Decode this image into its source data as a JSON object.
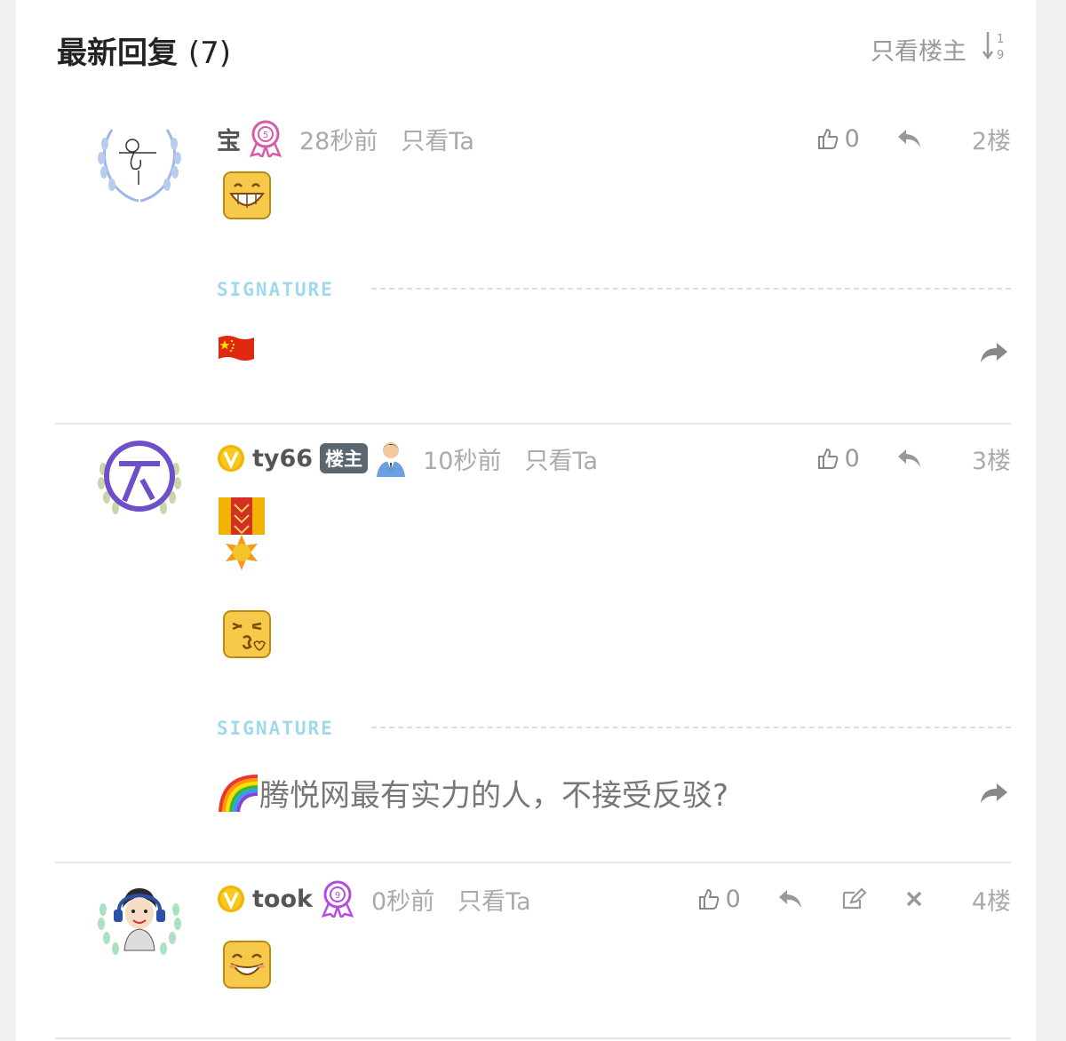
{
  "header": {
    "title": "最新回复",
    "count": "(7)",
    "only_op": "只看楼主"
  },
  "posts": [
    {
      "username": "宝",
      "time": "28秒前",
      "only_ta": "只看Ta",
      "likes": "0",
      "floor": "2楼",
      "signature_label": "SIGNATURE",
      "signature_text": ""
    },
    {
      "username": "ty66",
      "op_badge": "楼主",
      "time": "10秒前",
      "only_ta": "只看Ta",
      "likes": "0",
      "floor": "3楼",
      "signature_label": "SIGNATURE",
      "signature_text": "腾悦网最有实力的人，不接受反驳?"
    },
    {
      "username": "took",
      "time": "0秒前",
      "only_ta": "只看Ta",
      "likes": "0",
      "floor": "4楼"
    }
  ],
  "icons": [
    "sort-numeric-icon",
    "thumbs-up-icon",
    "reply-icon",
    "edit-icon",
    "close-icon",
    "share-arrow-icon",
    "vip-v-icon",
    "medal-icon",
    "flag-icon",
    "rainbow-icon"
  ],
  "colors": {
    "signature": "#9fd9ec",
    "vip": "#f0b400",
    "medal": "#b44de0"
  }
}
